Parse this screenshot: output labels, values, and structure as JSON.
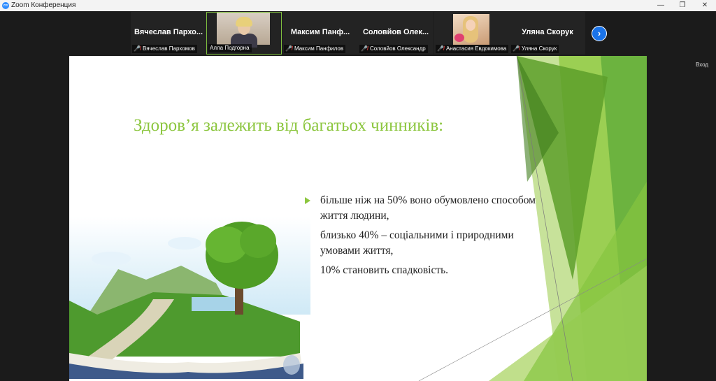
{
  "window": {
    "title": "Zoom Конференция",
    "app_icon_text": "zm",
    "controls": {
      "minimize": "—",
      "maximize": "❐",
      "close": "✕"
    }
  },
  "participants": [
    {
      "big_name": "Вячеслав  Пархо...",
      "caption": "Вячеслав Пархомов",
      "muted": true,
      "video": false
    },
    {
      "big_name": "",
      "caption": "Алла Подгорна",
      "muted": false,
      "video": true,
      "active": true
    },
    {
      "big_name": "Максим   Панф...",
      "caption": "Максим  Панфилов",
      "muted": true,
      "video": false
    },
    {
      "big_name": "Соловйов  Олек...",
      "caption": "Соловйов Олександр",
      "muted": true,
      "video": false
    },
    {
      "big_name": "",
      "caption": "Анастасия Евдокимова",
      "muted": true,
      "video": true
    },
    {
      "big_name": "Уляна Скорук",
      "caption": "Уляна Скорук",
      "muted": true,
      "video": false
    }
  ],
  "next_page_icon": "chevron-right",
  "side_label": "Вход",
  "slide": {
    "title": "Здоров’я залежить від багатьох чинників:",
    "bullets": [
      "більше ніж на 50% воно обумовлено способом життя людини,",
      " близько 40% – соціальними і природними умовами життя,",
      "10% становить спадковість."
    ],
    "accent_color": "#8cc63f"
  }
}
